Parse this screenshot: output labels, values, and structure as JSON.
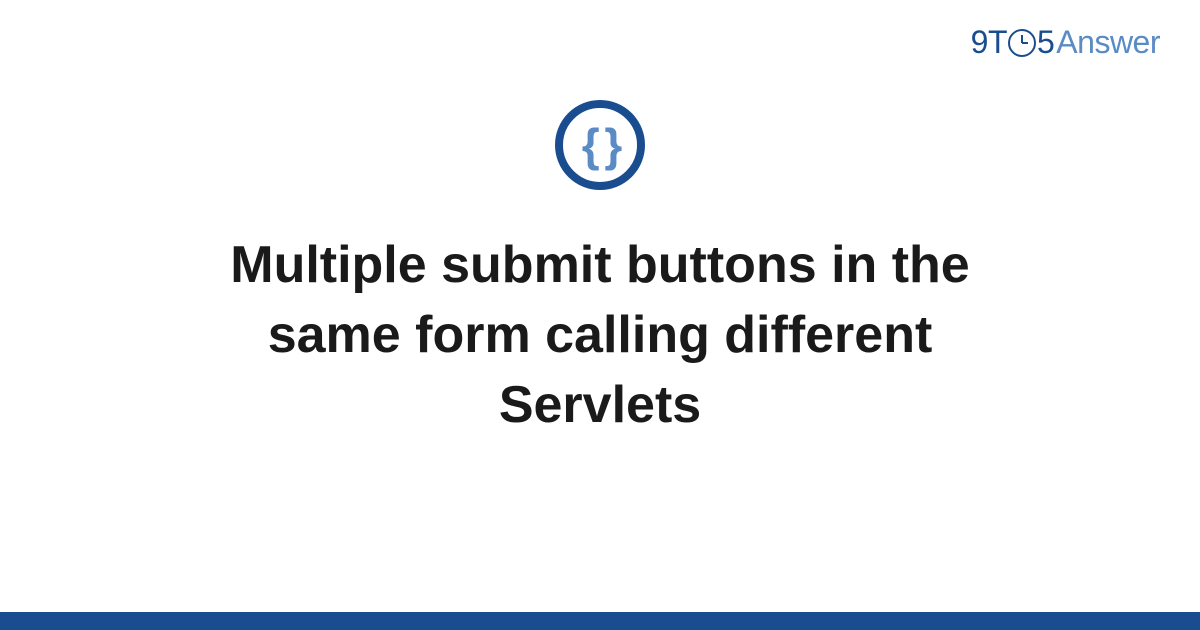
{
  "brand": {
    "part1": "9",
    "part2": "T",
    "part3": "5",
    "part4": "Answer"
  },
  "icon": {
    "glyph": "{ }",
    "name": "code-braces-icon"
  },
  "title": "Multiple submit buttons in the same form calling different Servlets",
  "colors": {
    "primary": "#1a4d8f",
    "accent": "#5a8bc4",
    "text": "#1a1a1a"
  }
}
